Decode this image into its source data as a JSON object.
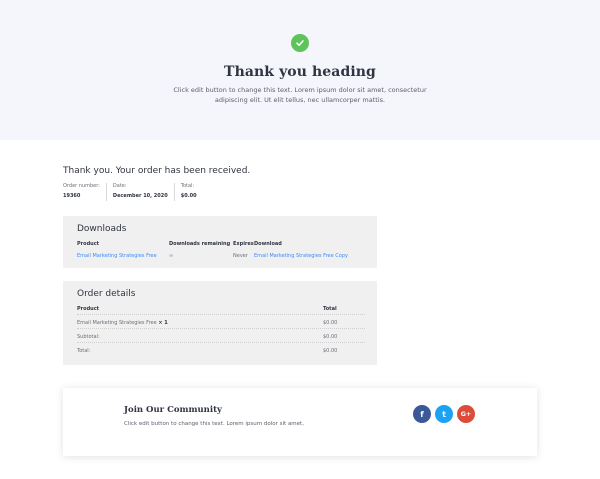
{
  "hero": {
    "title": "Thank you heading",
    "text": "Click edit button to change this text. Lorem ipsum dolor sit amet, consectetur adipiscing elit. Ut elit tellus, nec ullamcorper mattis.",
    "icon": "check-circle-icon",
    "icon_color": "#5fc35b"
  },
  "order": {
    "received_text": "Thank you. Your order has been received.",
    "meta": [
      {
        "label": "Order number:",
        "value": "19360"
      },
      {
        "label": "Date:",
        "value": "December 10, 2020"
      },
      {
        "label": "Total:",
        "value": "$0.00"
      }
    ]
  },
  "downloads": {
    "title": "Downloads",
    "headers": {
      "product": "Product",
      "remaining": "Downloads remaining",
      "expires": "Expires",
      "download": "Download"
    },
    "row": {
      "product": "Email Marketing Strategies Free",
      "remaining": "∞",
      "expires": "Never",
      "download": "Email Marketing Strategies Free Copy"
    }
  },
  "order_details": {
    "title": "Order details",
    "headers": {
      "product": "Product",
      "total": "Total"
    },
    "item": {
      "name": "Email Marketing Strategies Free",
      "qty": "× 1",
      "total": "$0.00"
    },
    "subtotal": {
      "label": "Subtotal:",
      "value": "$0.00"
    },
    "total": {
      "label": "Total:",
      "value": "$0.00"
    }
  },
  "community": {
    "title": "Join Our Community",
    "text": "Click edit button to change this text. Lorem ipsum dolor sit amet,",
    "social": [
      {
        "icon": "facebook-icon",
        "glyph": "f",
        "color": "#3b5998"
      },
      {
        "icon": "twitter-icon",
        "glyph": "t",
        "color": "#1da1f2"
      },
      {
        "icon": "google-plus-icon",
        "glyph": "G+",
        "color": "#dd4b39"
      }
    ]
  },
  "colors": {
    "link": "#3d8af7",
    "hero_bg": "#f4f6fb",
    "panel_bg": "#f0f0f0"
  }
}
